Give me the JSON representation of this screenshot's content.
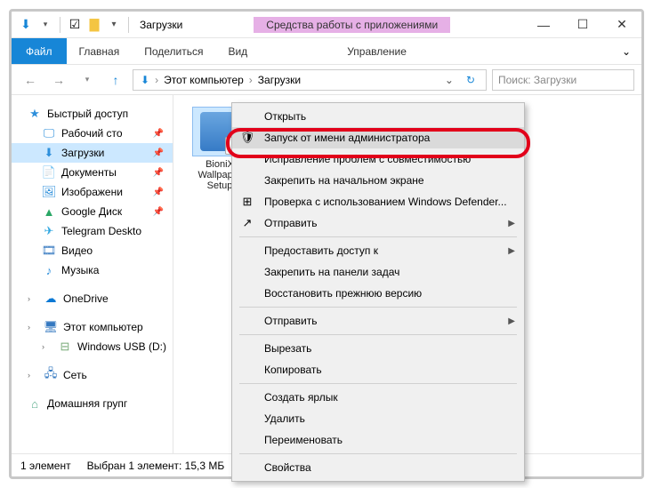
{
  "titlebar": {
    "title": "Загрузки",
    "tools_label": "Средства работы с приложениями"
  },
  "ribbon": {
    "file": "Файл",
    "tabs": [
      "Главная",
      "Поделиться",
      "Вид"
    ],
    "tool_tab": "Управление"
  },
  "breadcrumb": {
    "segments": [
      "Этот компьютер",
      "Загрузки"
    ]
  },
  "search": {
    "placeholder": "Поиск: Загрузки"
  },
  "sidebar": {
    "quick_access": "Быстрый доступ",
    "items": [
      {
        "label": "Рабочий сто",
        "type": "desktop",
        "pin": true
      },
      {
        "label": "Загрузки",
        "type": "downloads",
        "pin": true,
        "selected": true
      },
      {
        "label": "Документы",
        "type": "documents",
        "pin": true
      },
      {
        "label": "Изображени",
        "type": "pictures",
        "pin": true
      },
      {
        "label": "Google Диск",
        "type": "gdrive",
        "pin": true
      },
      {
        "label": "Telegram Deskto",
        "type": "telegram"
      },
      {
        "label": "Видео",
        "type": "videos"
      },
      {
        "label": "Музыка",
        "type": "music"
      }
    ],
    "onedrive": "OneDrive",
    "thispc": "Этот компьютер",
    "usb": "Windows USB (D:)",
    "network": "Сеть",
    "homegroup": "Домашняя групг"
  },
  "file": {
    "name_line1": "BioniX",
    "name_line2": "Wallpaper",
    "name_line3": "Setup"
  },
  "context_menu": [
    {
      "label": "Открыть",
      "icon": ""
    },
    {
      "label": "Запуск от имени администратора",
      "icon": "shield",
      "highlight": true
    },
    {
      "label": "Исправление проблем с совместимостью",
      "icon": ""
    },
    {
      "label": "Закрепить на начальном экране",
      "icon": ""
    },
    {
      "label": "Проверка с использованием Windows Defender...",
      "icon": "defender"
    },
    {
      "label": "Отправить",
      "icon": "share",
      "sub": true
    },
    {
      "sep": true
    },
    {
      "label": "Предоставить доступ к",
      "icon": "",
      "sub": true
    },
    {
      "label": "Закрепить на панели задач",
      "icon": ""
    },
    {
      "label": "Восстановить прежнюю версию",
      "icon": ""
    },
    {
      "sep": true
    },
    {
      "label": "Отправить",
      "icon": "",
      "sub": true
    },
    {
      "sep": true
    },
    {
      "label": "Вырезать",
      "icon": ""
    },
    {
      "label": "Копировать",
      "icon": ""
    },
    {
      "sep": true
    },
    {
      "label": "Создать ярлык",
      "icon": ""
    },
    {
      "label": "Удалить",
      "icon": ""
    },
    {
      "label": "Переименовать",
      "icon": ""
    },
    {
      "sep": true
    },
    {
      "label": "Свойства",
      "icon": ""
    }
  ],
  "status": {
    "count": "1 элемент",
    "selection": "Выбран 1 элемент: 15,3 МБ"
  }
}
